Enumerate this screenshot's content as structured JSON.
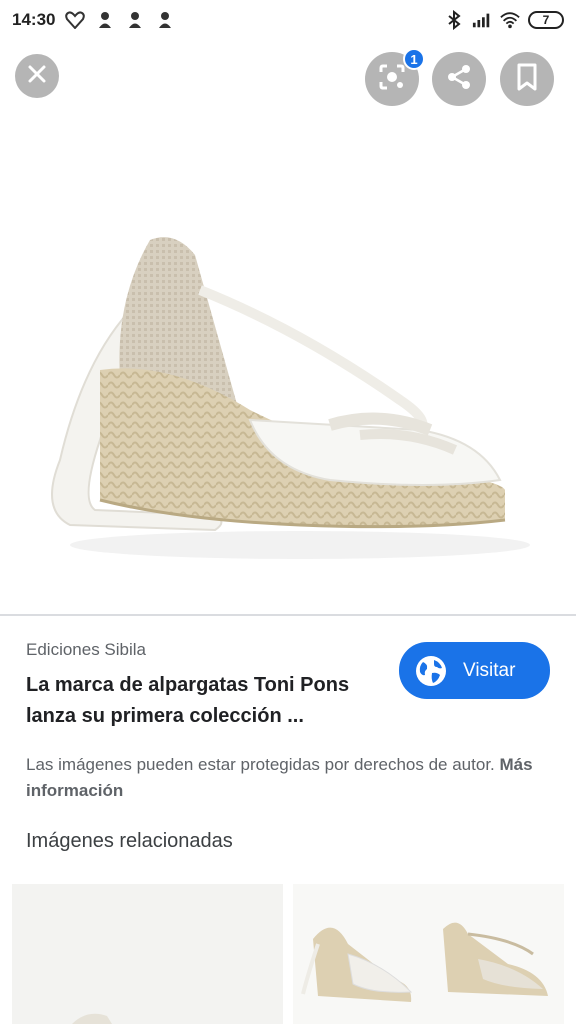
{
  "status_bar": {
    "time": "14:30",
    "battery": "7"
  },
  "toolbar": {
    "lens_badge": "1"
  },
  "result": {
    "source": "Ediciones Sibila",
    "title_line1": "La marca de alpargatas Toni Pons",
    "title_line2": "lanza su primera colección ...",
    "visit_label": "Visitar",
    "copyright_text": "Las imágenes pueden estar protegidas por derechos de autor.",
    "more_info": "Más información"
  },
  "related": {
    "heading": "Imágenes relacionadas"
  },
  "colors": {
    "accent": "#1a73e8",
    "overlay_button": "#8a8a8a"
  },
  "icons": [
    "close-icon",
    "lens-icon",
    "share-icon",
    "bookmark-icon",
    "globe-icon"
  ]
}
